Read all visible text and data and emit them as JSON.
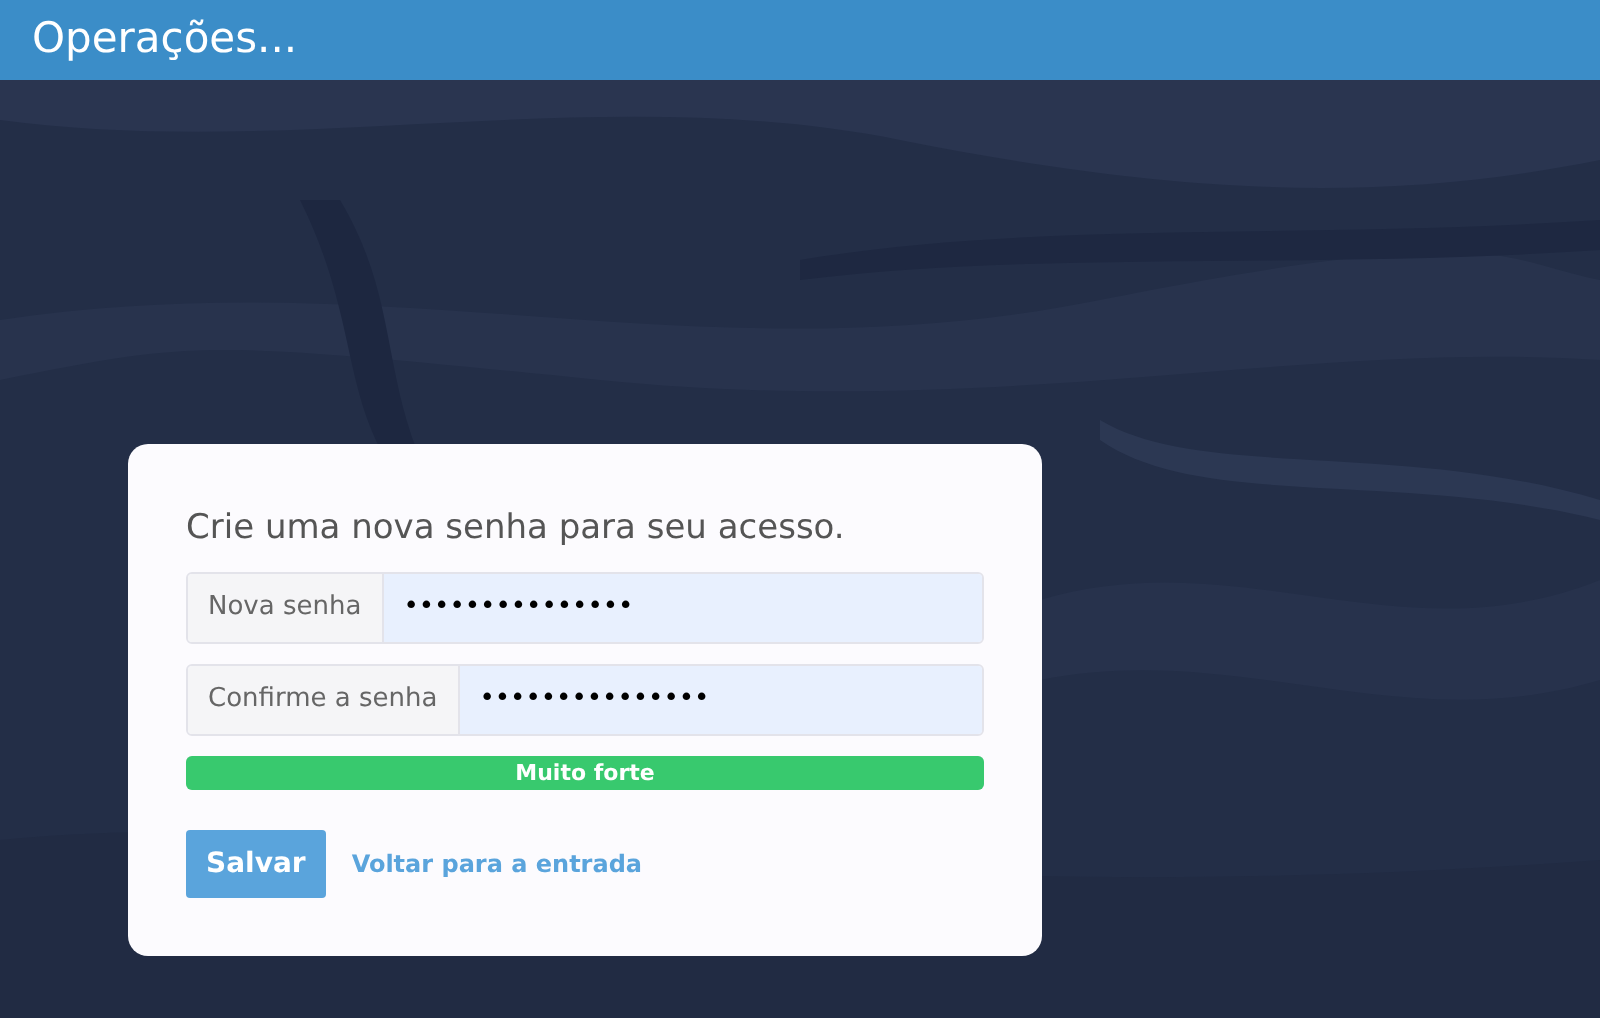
{
  "header": {
    "title": "Operações..."
  },
  "form": {
    "heading": "Crie uma nova senha para seu acesso.",
    "fields": [
      {
        "label": "Nova senha",
        "value": "•••••••••••••••"
      },
      {
        "label": "Confirme a senha",
        "value": "•••••••••••••••"
      }
    ],
    "strength": {
      "level": 1,
      "label": "Muito forte"
    },
    "submit": "Salvar",
    "back_link": "Voltar para a entrada"
  }
}
